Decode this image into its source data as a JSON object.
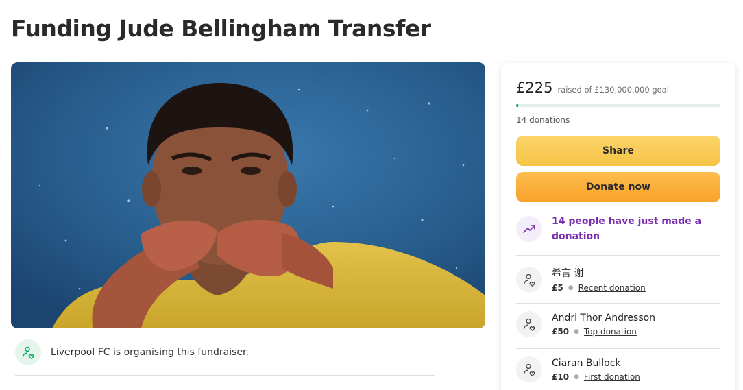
{
  "page": {
    "title": "Funding Jude Bellingham Transfer"
  },
  "organiser": {
    "text": "Liverpool FC is organising this fundraiser.",
    "icon": "person-heart-icon"
  },
  "fundraising": {
    "raised": "£225",
    "goal_text": "raised of £130,000,000 goal",
    "progress_fraction": 1.7e-06,
    "donation_count": "14 donations"
  },
  "buttons": {
    "share": "Share",
    "donate": "Donate now"
  },
  "trend": {
    "icon": "trending-up-icon",
    "text": "14 people have just made a donation"
  },
  "donations": [
    {
      "name": "希言 谢",
      "amount": "£5",
      "tag": "Recent donation"
    },
    {
      "name": "Andri Thor Andresson",
      "amount": "£50",
      "tag": "Top donation"
    },
    {
      "name": "Ciaran Bullock",
      "amount": "£10",
      "tag": "First donation"
    }
  ],
  "colors": {
    "accent_green": "#02a95c",
    "share_yellow": "#f6c446",
    "donate_orange": "#f8a22a",
    "trend_purple": "#7a2fb0"
  }
}
